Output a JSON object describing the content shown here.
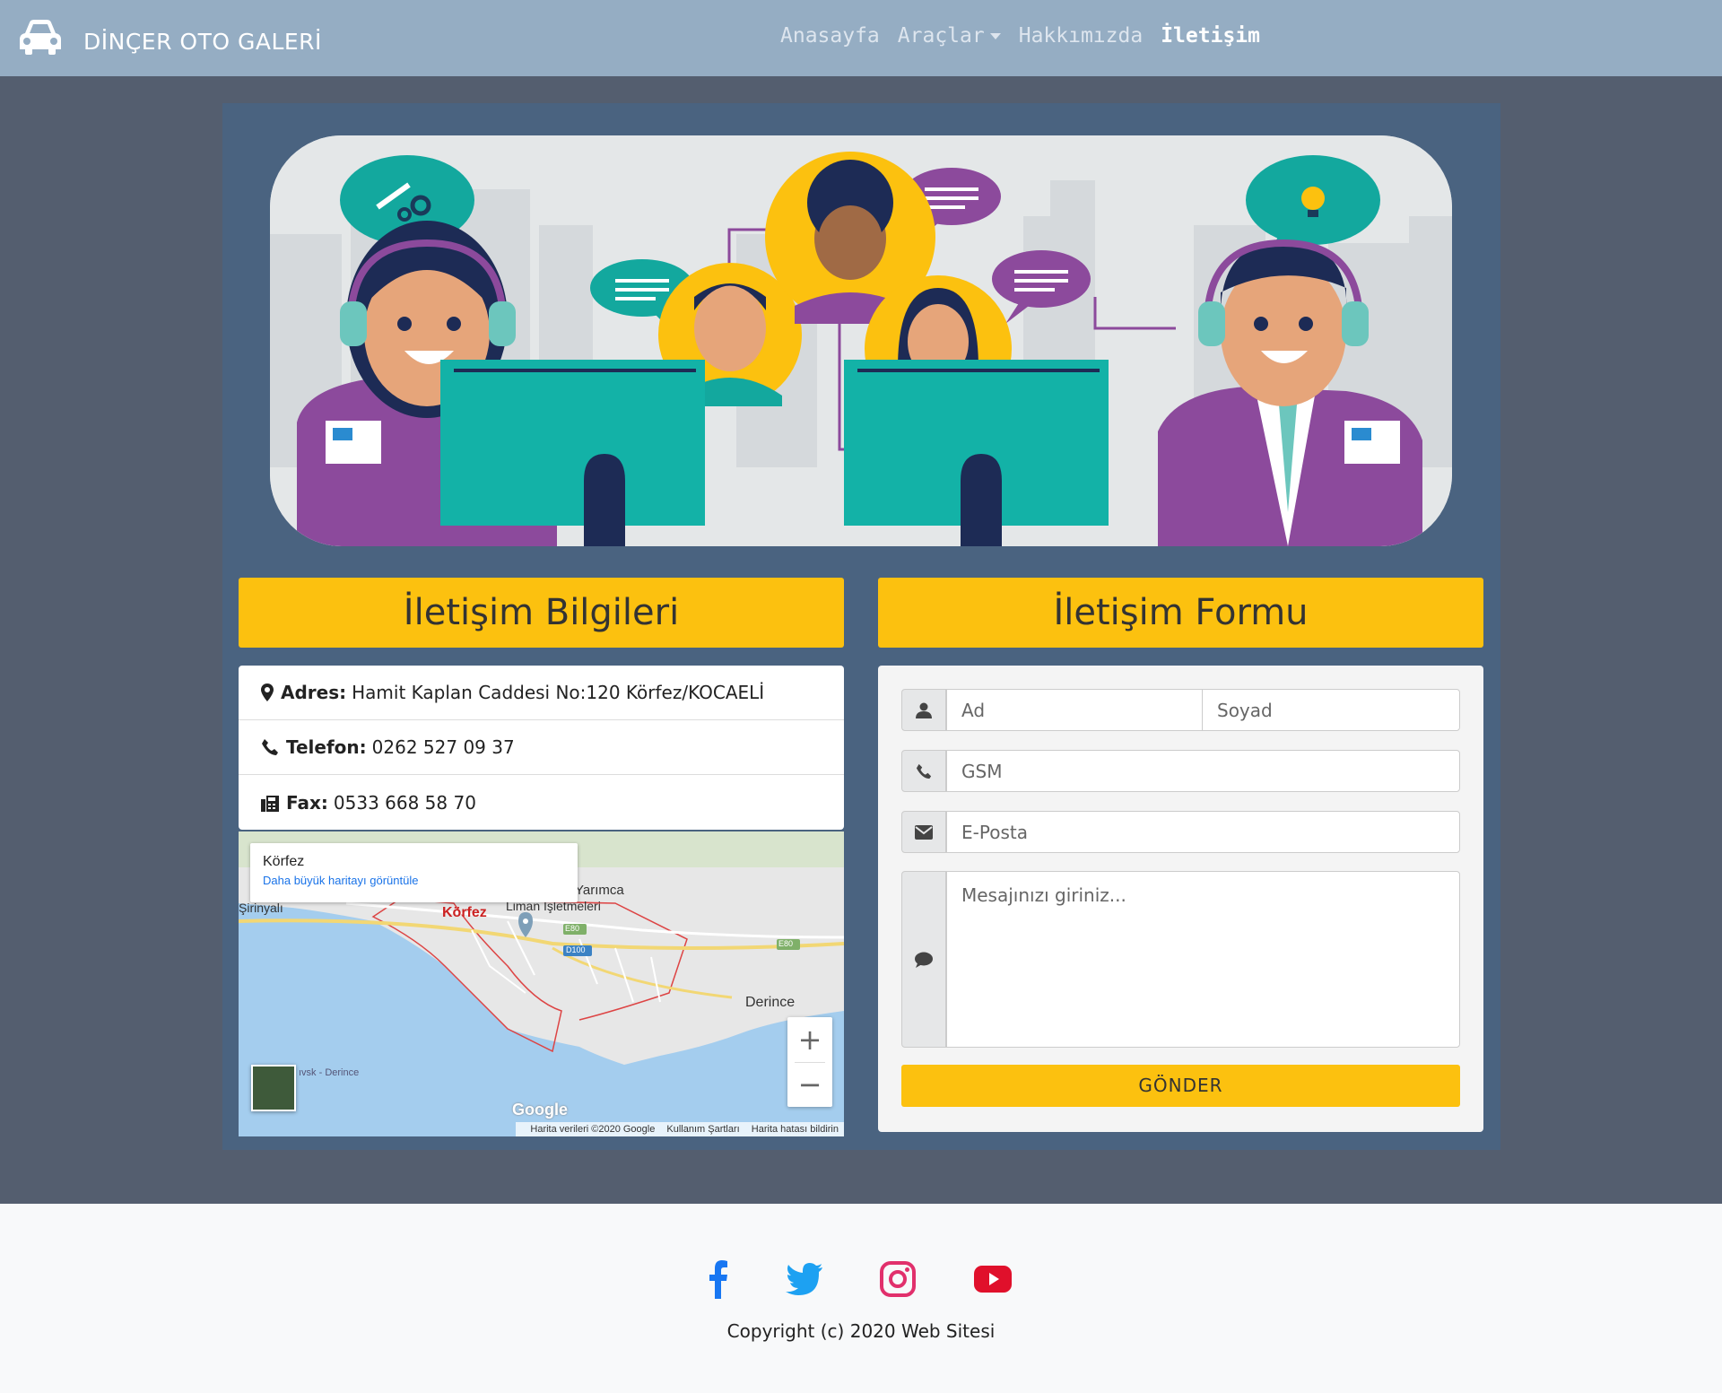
{
  "brand": {
    "title": "DİNÇER OTO GALERİ",
    "icon": "car-icon"
  },
  "nav": {
    "items": [
      {
        "label": "Anasayfa"
      },
      {
        "label": "Araçlar"
      },
      {
        "label": "Hakkımızda"
      },
      {
        "label": "İletişim"
      }
    ]
  },
  "hero": {
    "illustration": "call-center-illustration"
  },
  "contact_info": {
    "heading": "İletişim Bilgileri",
    "address": {
      "label": "Adres:",
      "value": "Hamit Kaplan Caddesi No:120 Körfez/KOCAELİ",
      "icon": "map-marker-icon"
    },
    "phone": {
      "label": "Telefon:",
      "value": "0262 527 09 37",
      "icon": "phone-icon"
    },
    "fax": {
      "label": "Fax:",
      "value": "0533 668 58 70",
      "icon": "fax-icon"
    }
  },
  "map": {
    "place_title": "Körfez",
    "larger_map_link": "Daha büyük haritayı görüntüle",
    "labels": {
      "korfez": "Körfez",
      "yarimca": "Yarımca",
      "liman": "Liman İşletmeleri",
      "sirinyali": "Şirinyalı",
      "derince": "Derince",
      "e80a": "E80",
      "e80b": "E80",
      "d100": "D100",
      "derince_road": "ıvsk - Derince"
    },
    "zoom_in": "+",
    "zoom_out": "−",
    "google": "Google",
    "footer": {
      "data": "Harita verileri ©2020 Google",
      "terms": "Kullanım Şartları",
      "report": "Harita hatası bildirin"
    }
  },
  "contact_form": {
    "heading": "İletişim Formu",
    "first_name_placeholder": "Ad",
    "last_name_placeholder": "Soyad",
    "gsm_placeholder": "GSM",
    "email_placeholder": "E-Posta",
    "message_placeholder": "Mesajınızı giriniz...",
    "submit_label": "GÖNDER"
  },
  "footer": {
    "social": [
      "facebook-icon",
      "twitter-icon",
      "instagram-icon",
      "youtube-icon"
    ],
    "copyright": "Copyright (c) 2020 Web Sitesi"
  },
  "colors": {
    "navbar": "#95adc3",
    "page_bg": "#545e6f",
    "panel": "#4a6380",
    "accent": "#fcc10f"
  }
}
